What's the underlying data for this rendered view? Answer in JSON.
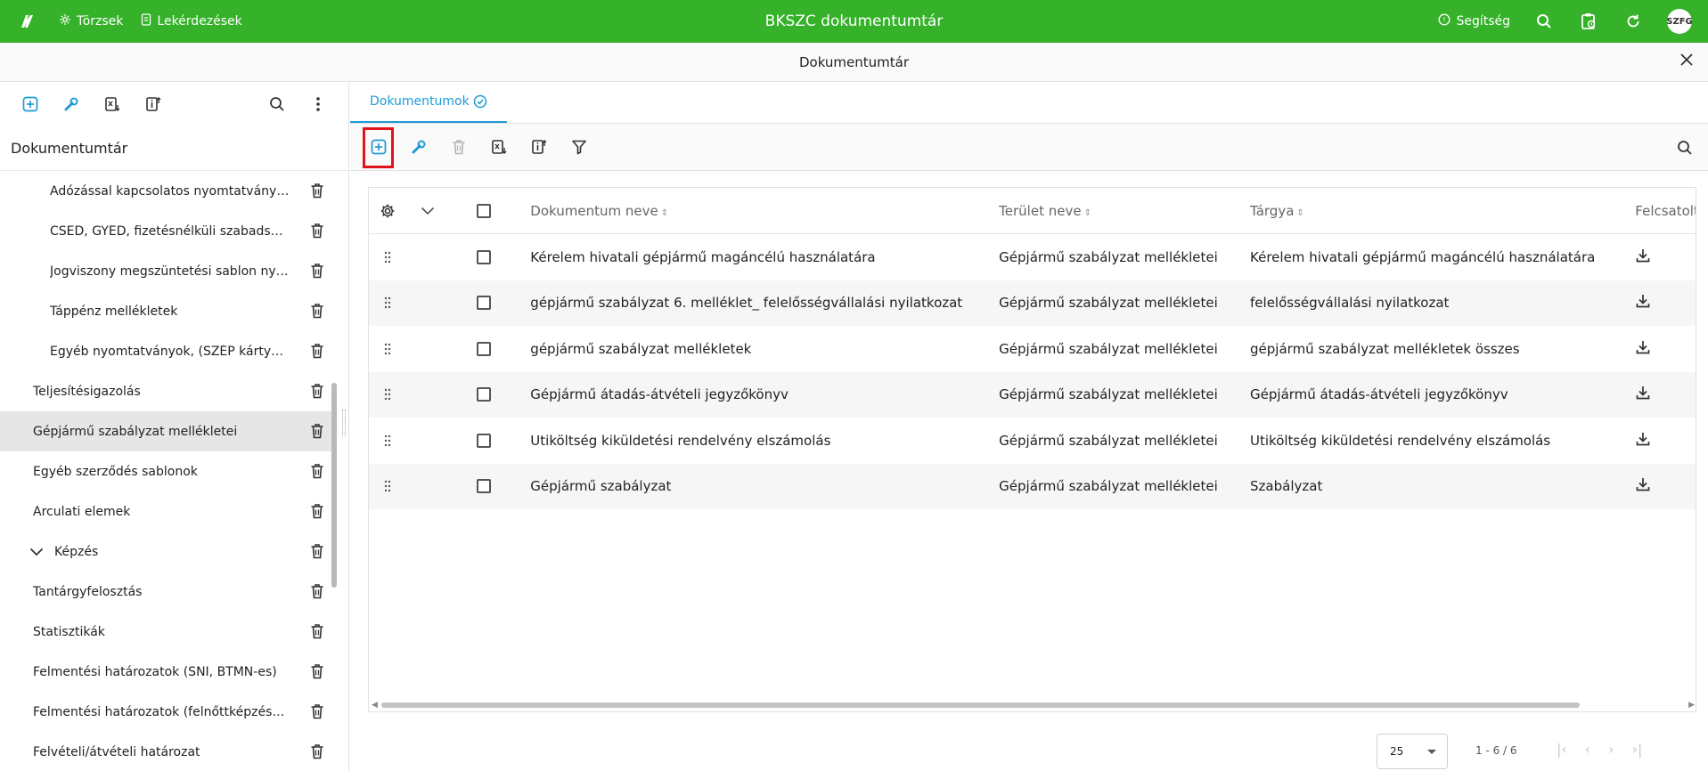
{
  "topbar": {
    "nav": [
      "Törzsek",
      "Lekérdezések"
    ],
    "title": "BKSZC dokumentumtár",
    "help": "Segítség",
    "avatar": "SZFG",
    "color": "#35b12a"
  },
  "subbar": {
    "title": "Dokumentumtár"
  },
  "sidebar": {
    "title": "Dokumentumtár",
    "items": [
      {
        "label": "Adózással kapcsolatos nyomtatványo...",
        "level": 2
      },
      {
        "label": "CSED, GYED, fizetésnélküli szabadság n...",
        "level": 2
      },
      {
        "label": "Jogviszony megszüntetési sablon nyo...",
        "level": 2
      },
      {
        "label": "Táppénz mellékletek",
        "level": 2
      },
      {
        "label": "Egyéb nyomtatványok, (SZÉP kártya ny...",
        "level": 2
      },
      {
        "label": "Teljesítésigazolás",
        "level": 1
      },
      {
        "label": "Gépjármű szabályzat mellékletei",
        "level": 1,
        "selected": true
      },
      {
        "label": "Egyéb szerződés sablonok",
        "level": 1
      },
      {
        "label": "Arculati elemek",
        "level": 1
      },
      {
        "label": "Képzés",
        "level": 1,
        "expandable": true
      },
      {
        "label": "Tantárgyfelosztás",
        "level": 1
      },
      {
        "label": "Statisztikák",
        "level": 1
      },
      {
        "label": "Felmentési határozatok (SNI, BTMN-es)",
        "level": 1
      },
      {
        "label": "Felmentési határozatok (felnőttképzésen, ...",
        "level": 1
      },
      {
        "label": "Felvételi/átvételi határozat",
        "level": 1
      }
    ]
  },
  "main": {
    "tab": "Dokumentumok",
    "accent": "#1e9bd7",
    "highlight_color": "#e0141d",
    "columns": {
      "name": "Dokumentum neve",
      "area": "Terület neve",
      "subject": "Tárgya",
      "upload": "Felcsatolt"
    },
    "rows": [
      {
        "name": "Kérelem hivatali gépjármű magáncélú használatára",
        "area": "Gépjármű szabályzat mellékletei",
        "subject": "Kérelem hivatali gépjármű magáncélú használatára"
      },
      {
        "name": "gépjármű szabályzat 6. melléklet_ felelősségvállalási nyilatkozat",
        "area": "Gépjármű szabályzat mellékletei",
        "subject": "felelősségvállalási nyilatkozat"
      },
      {
        "name": "gépjármű szabályzat mellékletek",
        "area": "Gépjármű szabályzat mellékletei",
        "subject": "gépjármű szabályzat mellékletek összes"
      },
      {
        "name": "Gépjármű átadás-átvételi jegyzőkönyv",
        "area": "Gépjármű szabályzat mellékletei",
        "subject": "Gépjármű átadás-átvételi jegyzőkönyv"
      },
      {
        "name": "Utiköltség kiküldetési rendelvény elszámolás",
        "area": "Gépjármű szabályzat mellékletei",
        "subject": "Utiköltség kiküldetési rendelvény elszámolás"
      },
      {
        "name": "Gépjármű szabályzat",
        "area": "Gépjármű szabályzat mellékletei",
        "subject": "Szabályzat"
      }
    ]
  },
  "pager": {
    "page_size": "25",
    "info": "1 - 6 / 6"
  }
}
